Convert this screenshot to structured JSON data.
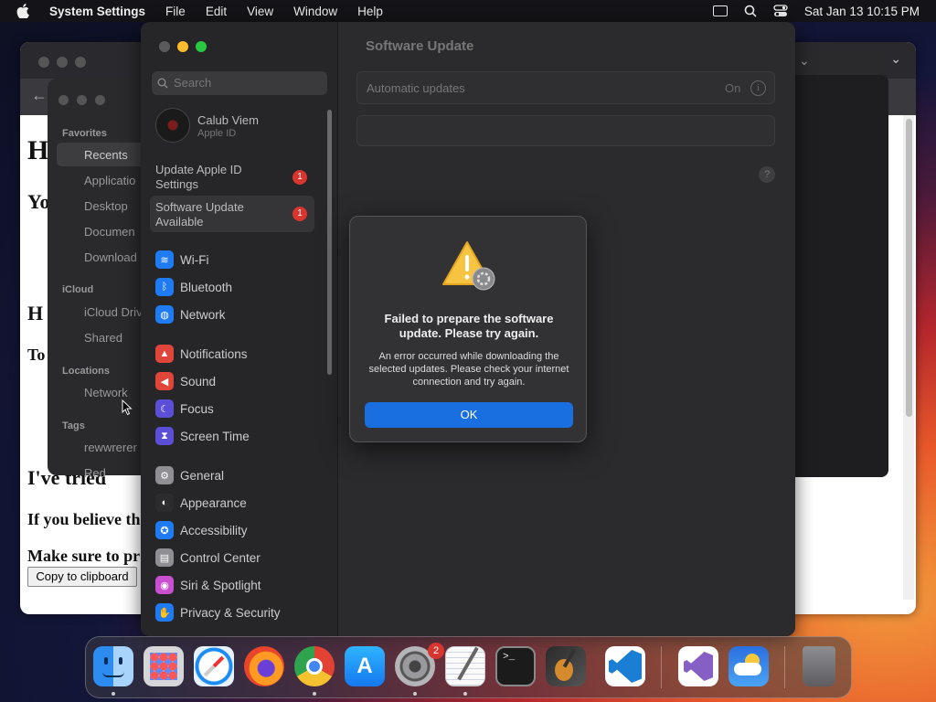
{
  "menubar": {
    "app": "System Settings",
    "menus": [
      "File",
      "Edit",
      "View",
      "Window",
      "Help"
    ],
    "datetime": "Sat Jan 13  10:15 PM"
  },
  "browser": {
    "h1": "H",
    "p1": "Yo",
    "h2": "H",
    "p2": "To",
    "p3": "I've tried",
    "p4": "If you believe th",
    "p5": "Make sure to pr",
    "copy_button": "Copy to clipboard"
  },
  "finder": {
    "favorites_header": "Favorites",
    "favorites": [
      "Recents",
      "Applicatio",
      "Desktop",
      "Documen",
      "Download"
    ],
    "icloud_header": "iCloud",
    "icloud": [
      "iCloud Driv",
      "Shared"
    ],
    "locations_header": "Locations",
    "locations": [
      "Network"
    ],
    "tags_header": "Tags",
    "tags": [
      "rewwrerer",
      "Red"
    ]
  },
  "settings": {
    "search_placeholder": "Search",
    "account_name": "Calub Viem",
    "account_sub": "Apple ID",
    "update_apple_id": "Update Apple ID Settings",
    "update_badge": "1",
    "software_update_available": "Software Update Available",
    "software_badge": "1",
    "items": [
      {
        "label": "Wi-Fi",
        "icon": "wifi-icon",
        "color": "#1f7bf2"
      },
      {
        "label": "Bluetooth",
        "icon": "bluetooth-icon",
        "color": "#1f7bf2"
      },
      {
        "label": "Network",
        "icon": "globe-icon",
        "color": "#1f7bf2"
      },
      {
        "label": "Notifications",
        "icon": "bell-icon",
        "color": "#e0453a"
      },
      {
        "label": "Sound",
        "icon": "speaker-icon",
        "color": "#e0453a"
      },
      {
        "label": "Focus",
        "icon": "moon-icon",
        "color": "#5b4fd8"
      },
      {
        "label": "Screen Time",
        "icon": "hourglass-icon",
        "color": "#5b4fd8"
      },
      {
        "label": "General",
        "icon": "gear-icon",
        "color": "#8e8e93"
      },
      {
        "label": "Appearance",
        "icon": "appearance-icon",
        "color": "#2c2c2e"
      },
      {
        "label": "Accessibility",
        "icon": "accessibility-icon",
        "color": "#1f7bf2"
      },
      {
        "label": "Control Center",
        "icon": "control-center-icon",
        "color": "#8e8e93"
      },
      {
        "label": "Siri & Spotlight",
        "icon": "siri-icon",
        "color": "#c84fd0"
      },
      {
        "label": "Privacy & Security",
        "icon": "hand-icon",
        "color": "#1f7bf2"
      }
    ],
    "main_title": "Software Update",
    "automatic_updates_label": "Automatic updates",
    "automatic_updates_value": "On"
  },
  "alert": {
    "title": "Failed to prepare the software update. Please try again.",
    "message": "An error occurred while downloading the selected updates. Please check your internet connection and try again.",
    "ok_button": "OK"
  },
  "dock": {
    "apps": [
      "finder-icon",
      "launchpad-icon",
      "safari-icon",
      "firefox-icon",
      "chrome-icon",
      "app-store-icon",
      "system-settings-icon",
      "textedit-icon",
      "terminal-icon",
      "garageband-icon",
      "vscode-icon",
      "visual-studio-icon",
      "weather-icon",
      "trash-icon"
    ],
    "settings_badge": "2"
  }
}
